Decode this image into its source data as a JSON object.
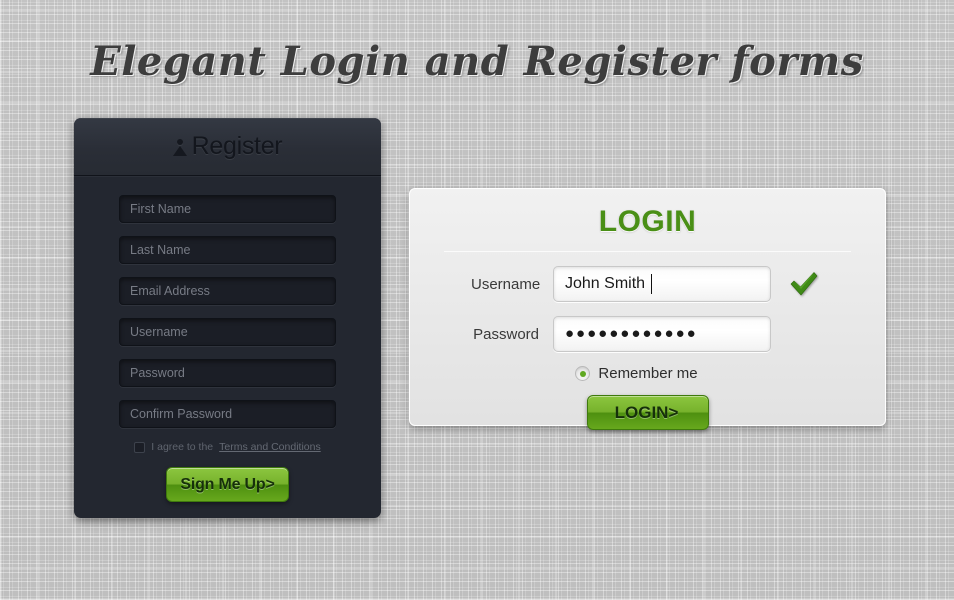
{
  "page": {
    "title": "Elegant Login and Register forms"
  },
  "register": {
    "header_title": "Register",
    "header_icon": "person-icon",
    "fields": [
      {
        "name": "first-name",
        "placeholder": "First Name"
      },
      {
        "name": "last-name",
        "placeholder": "Last Name"
      },
      {
        "name": "email-address",
        "placeholder": "Email Address"
      },
      {
        "name": "username",
        "placeholder": "Username"
      },
      {
        "name": "password",
        "placeholder": "Password"
      },
      {
        "name": "confirm-password",
        "placeholder": "Confirm Password"
      }
    ],
    "terms": {
      "text": "I agree to the",
      "link": "Terms and Conditions",
      "checked": false
    },
    "submit_label": "Sign Me Up>"
  },
  "login": {
    "title": "LOGIN",
    "username": {
      "label": "Username",
      "value": "John Smith",
      "valid_icon": "check-icon"
    },
    "password": {
      "label": "Password",
      "value": "●●●●●●●●●●●●"
    },
    "remember": {
      "label": "Remember me",
      "selected": true
    },
    "submit_label": "LOGIN>"
  },
  "colors": {
    "accent_green": "#4a8f16",
    "button_green_light": "#8cc63f",
    "button_green_dark": "#4e9010",
    "panel_dark": "#232730",
    "panel_dark_header": "#2a2e37",
    "panel_light": "#e9e9e9",
    "background": "#cdcdcd"
  }
}
